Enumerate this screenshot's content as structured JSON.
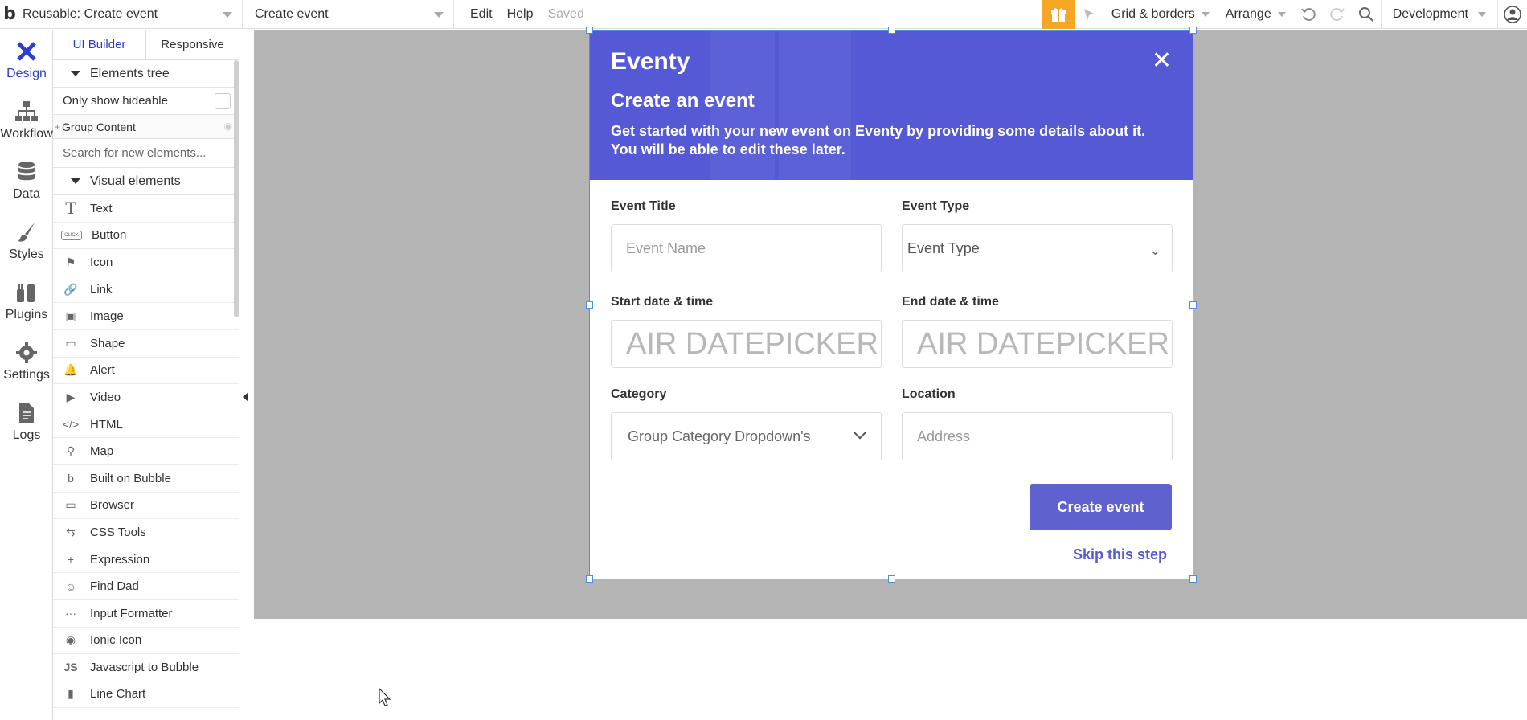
{
  "topbar": {
    "logo": "b",
    "page": "Reusable: Create event",
    "page2": "Create event",
    "menu": [
      "Edit",
      "Help"
    ],
    "saved": "Saved",
    "grid": "Grid & borders",
    "arrange": "Arrange",
    "environment": "Development",
    "accent_color": "#f5a623"
  },
  "rail": {
    "items": [
      {
        "label": "Design",
        "icon": "design-icon"
      },
      {
        "label": "Workflow",
        "icon": "workflow-icon"
      },
      {
        "label": "Data",
        "icon": "database-icon"
      },
      {
        "label": "Styles",
        "icon": "brush-icon"
      },
      {
        "label": "Plugins",
        "icon": "plugin-icon"
      },
      {
        "label": "Settings",
        "icon": "gear-icon"
      },
      {
        "label": "Logs",
        "icon": "document-icon"
      }
    ]
  },
  "panel": {
    "tabs": [
      "UI Builder",
      "Responsive"
    ],
    "elements_tree": "Elements tree",
    "only_show_hideable": "Only show hideable",
    "group_content": "Group Content",
    "search_placeholder": "Search for new elements...",
    "visual_elements": "Visual elements",
    "items": [
      {
        "label": "Text",
        "icon": "T"
      },
      {
        "label": "Button",
        "icon": "CLICK"
      },
      {
        "label": "Icon",
        "icon": "⚑"
      },
      {
        "label": "Link",
        "icon": "🔗"
      },
      {
        "label": "Image",
        "icon": "▣"
      },
      {
        "label": "Shape",
        "icon": "▭"
      },
      {
        "label": "Alert",
        "icon": "🔔"
      },
      {
        "label": "Video",
        "icon": "▶"
      },
      {
        "label": "HTML",
        "icon": "</>"
      },
      {
        "label": "Map",
        "icon": "⚲"
      },
      {
        "label": "Built on Bubble",
        "icon": "b"
      },
      {
        "label": "Browser",
        "icon": "▭"
      },
      {
        "label": "CSS Tools",
        "icon": "⇆"
      },
      {
        "label": "Expression",
        "icon": "+"
      },
      {
        "label": "Find Dad",
        "icon": "☺"
      },
      {
        "label": "Input Formatter",
        "icon": "···"
      },
      {
        "label": "Ionic Icon",
        "icon": "◉"
      },
      {
        "label": "Javascript to Bubble",
        "icon": "JS"
      },
      {
        "label": "Line Chart",
        "icon": "▮"
      }
    ]
  },
  "modal": {
    "brand": "Eventy",
    "title": "Create an event",
    "description": "Get started with your new event on Eventy by providing some details about it. You will be able to edit these later.",
    "header_color": "#5559d6",
    "fields": {
      "event_title_label": "Event Title",
      "event_title_placeholder": "Event Name",
      "event_type_label": "Event Type",
      "event_type_value": "Event Type",
      "start_label": "Start date & time",
      "start_value": "AIR DATEPICKER",
      "end_label": "End date & time",
      "end_value": "AIR DATEPICKER",
      "category_label": "Category",
      "category_value": "Group Category Dropdown's",
      "location_label": "Location",
      "location_placeholder": "Address"
    },
    "create_button": "Create event",
    "skip_link": "Skip this step"
  }
}
